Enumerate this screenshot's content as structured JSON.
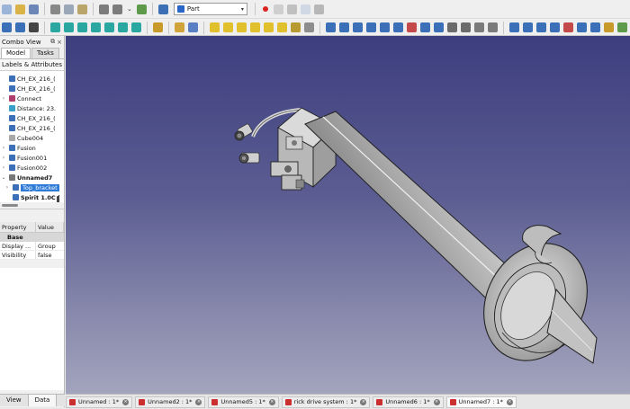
{
  "toolbar": {
    "workbench": "Part",
    "row1_icons": [
      {
        "name": "new-file-icon",
        "color": "#9bb4d8"
      },
      {
        "name": "open-folder-icon",
        "color": "#d9b347"
      },
      {
        "name": "save-icon",
        "color": "#6a87b8"
      },
      {
        "name": "cut-icon",
        "color": "#888888"
      },
      {
        "name": "copy-icon",
        "color": "#9aa7b8"
      },
      {
        "name": "paste-icon",
        "color": "#b9a46a"
      },
      {
        "name": "undo-icon",
        "color": "#7c7c7c"
      },
      {
        "name": "redo-icon",
        "color": "#7c7c7c"
      },
      {
        "name": "refresh-icon",
        "color": "#5d9b4a"
      },
      {
        "name": "whats-this-icon",
        "color": "#3c6fb4"
      }
    ],
    "row2_icons": [
      {
        "name": "fit-all-icon",
        "color": "#3b6fb8"
      },
      {
        "name": "fit-selection-icon",
        "color": "#3b6fb8"
      },
      {
        "name": "draw-style-icon",
        "color": "#444444"
      },
      {
        "name": "isometric-view-icon",
        "color": "#2aa7a0"
      },
      {
        "name": "front-view-icon",
        "color": "#2aa7a0"
      },
      {
        "name": "top-view-icon",
        "color": "#2aa7a0"
      },
      {
        "name": "right-view-icon",
        "color": "#2aa7a0"
      },
      {
        "name": "rear-view-icon",
        "color": "#2aa7a0"
      },
      {
        "name": "bottom-view-icon",
        "color": "#2aa7a0"
      },
      {
        "name": "left-view-icon",
        "color": "#2aa7a0"
      },
      {
        "name": "measure-icon",
        "color": "#c89a2a"
      },
      {
        "name": "part-gear-icon",
        "color": "#d0a43a"
      },
      {
        "name": "part-folder-icon",
        "color": "#5b7fc4"
      },
      {
        "name": "box-icon",
        "color": "#e1c02d"
      },
      {
        "name": "cylinder-icon",
        "color": "#e1c02d"
      },
      {
        "name": "sphere-icon",
        "color": "#e1c02d"
      },
      {
        "name": "cone-icon",
        "color": "#e1c02d"
      },
      {
        "name": "torus-icon",
        "color": "#e1c02d"
      },
      {
        "name": "tube-icon",
        "color": "#e1c02d"
      },
      {
        "name": "primitives-icon",
        "color": "#b89a33"
      },
      {
        "name": "shape-builder-icon",
        "color": "#8d8d8d"
      },
      {
        "name": "extrude-icon",
        "color": "#3b6fb8"
      },
      {
        "name": "revolve-icon",
        "color": "#3b6fb8"
      },
      {
        "name": "mirror-icon",
        "color": "#3b6fb8"
      },
      {
        "name": "fillet-icon",
        "color": "#3b6fb8"
      },
      {
        "name": "chamfer-icon",
        "color": "#3b6fb8"
      },
      {
        "name": "make-face-icon",
        "color": "#3b6fb8"
      },
      {
        "name": "ruled-surface-icon",
        "color": "#c44a4a"
      },
      {
        "name": "loft-icon",
        "color": "#3b6fb8"
      },
      {
        "name": "sweep-icon",
        "color": "#3b6fb8"
      },
      {
        "name": "section-icon",
        "color": "#6b6b6b"
      },
      {
        "name": "cross-sections-icon",
        "color": "#6b6b6b"
      },
      {
        "name": "offset-icon",
        "color": "#7a7a7a"
      },
      {
        "name": "thickness-icon",
        "color": "#7a7a7a"
      },
      {
        "name": "boolean-icon",
        "color": "#3b6fb8"
      },
      {
        "name": "cut-boolean-icon",
        "color": "#3b6fb8"
      },
      {
        "name": "fuse-icon",
        "color": "#3b6fb8"
      },
      {
        "name": "common-icon",
        "color": "#3b6fb8"
      },
      {
        "name": "join-icon",
        "color": "#c44a4a"
      },
      {
        "name": "split-icon",
        "color": "#3b6fb8"
      },
      {
        "name": "compound-icon",
        "color": "#3b6fb8"
      },
      {
        "name": "check-geometry-icon",
        "color": "#c89a2a"
      },
      {
        "name": "defeaturing-icon",
        "color": "#5d9b4a"
      },
      {
        "name": "measure-linear-icon",
        "color": "#9c9c9c"
      },
      {
        "name": "measure-clear-icon",
        "color": "#c44a4a"
      }
    ]
  },
  "combo": {
    "title": "Combo View",
    "float_icon": "⧉",
    "close_icon": "×",
    "tabs": [
      "Model",
      "Tasks"
    ],
    "labels_header": "Labels & Attributes",
    "tree": [
      {
        "label": "CH_EX_216_(",
        "icon_color": "#3b6fb8",
        "arrow": "",
        "state": ""
      },
      {
        "label": "CH_EX_216_(",
        "icon_color": "#3b6fb8",
        "arrow": "",
        "state": ""
      },
      {
        "label": "Connect",
        "icon_color": "#b03c6e",
        "arrow": "›",
        "state": ""
      },
      {
        "label": "Distance: 23.",
        "icon_color": "#39a1c9",
        "arrow": "",
        "state": ""
      },
      {
        "label": "CH_EX_216_(",
        "icon_color": "#3b6fb8",
        "arrow": "",
        "state": ""
      },
      {
        "label": "CH_EX_216_(",
        "icon_color": "#3b6fb8",
        "arrow": "",
        "state": ""
      },
      {
        "label": "Cube004",
        "icon_color": "#a8a8a8",
        "arrow": "",
        "state": ""
      },
      {
        "label": "Fusion",
        "icon_color": "#3b6fb8",
        "arrow": "›",
        "state": ""
      },
      {
        "label": "Fusion001",
        "icon_color": "#3b6fb8",
        "arrow": "›",
        "state": ""
      },
      {
        "label": "Fusion002",
        "icon_color": "#3b6fb8",
        "arrow": "›",
        "state": ""
      },
      {
        "label": "Unnamed7",
        "icon_color": "#777777",
        "arrow": "⌄",
        "state": "bold"
      },
      {
        "label": "Top_bracket",
        "icon_color": "#3b6fb8",
        "arrow": "›",
        "state": "sel"
      },
      {
        "label": "Spirit 1.0C (",
        "icon_color": "#3b6fb8",
        "arrow": "",
        "state": "bold"
      }
    ],
    "property_header": [
      "Property",
      "Value"
    ],
    "property_group": "Base",
    "properties": [
      {
        "name": "Display ...",
        "value": "Group"
      },
      {
        "name": "Visibility",
        "value": "false"
      }
    ],
    "bottom_tabs": [
      "View",
      "Data"
    ]
  },
  "doc_tabs": [
    {
      "label": "Unnamed : 1*",
      "active": false
    },
    {
      "label": "Unnamed2 : 1*",
      "active": false
    },
    {
      "label": "Unnamed5 : 1*",
      "active": false
    },
    {
      "label": "rick drive system : 1*",
      "active": false
    },
    {
      "label": "Unnamed6 : 1*",
      "active": false
    },
    {
      "label": "Unnamed7 : 1*",
      "active": true
    }
  ],
  "colors": {
    "viewport_top": "#3d3e7e",
    "viewport_bottom": "#a3a4bd",
    "selection": "#2f7bd8",
    "part_body": "#c9c9c9",
    "part_shadow": "#9a9a9a"
  }
}
